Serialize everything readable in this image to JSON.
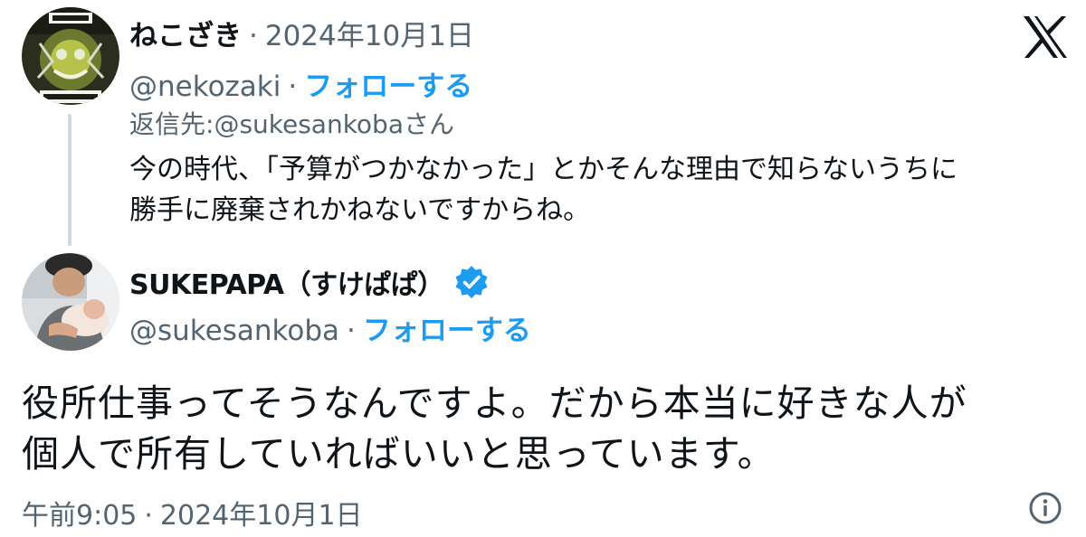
{
  "reply_tweet": {
    "display_name": "ねこざき",
    "separator": "·",
    "date": "2024年10月1日",
    "handle": "@nekozaki",
    "follow_label": "フォローする",
    "reply_prefix": "返信先: ",
    "reply_to_handle": "@sukesankoba",
    "reply_suffix": "さん",
    "text_line1": "今の時代、「予算がつかなかった」とかそんな理由で知らないうちに",
    "text_line2": "勝手に廃棄されかねないですからね。"
  },
  "main_tweet": {
    "display_name": "SUKEPAPA（すけぱぱ）",
    "verified": true,
    "handle": "@sukesankoba",
    "separator": "·",
    "follow_label": "フォローする",
    "text_line1": "役所仕事ってそうなんですよ。だから本当に好きな人が",
    "text_line2": "個人で所有していればいいと思っています。",
    "time": "午前9:05",
    "date": "2024年10月1日"
  },
  "icons": {
    "brand": "x-logo-icon",
    "info": "info-icon",
    "verified": "verified-badge-icon"
  },
  "colors": {
    "link": "#1d9bf0",
    "muted": "#536471",
    "text": "#0f1419",
    "thread_line": "#cfd9de"
  }
}
